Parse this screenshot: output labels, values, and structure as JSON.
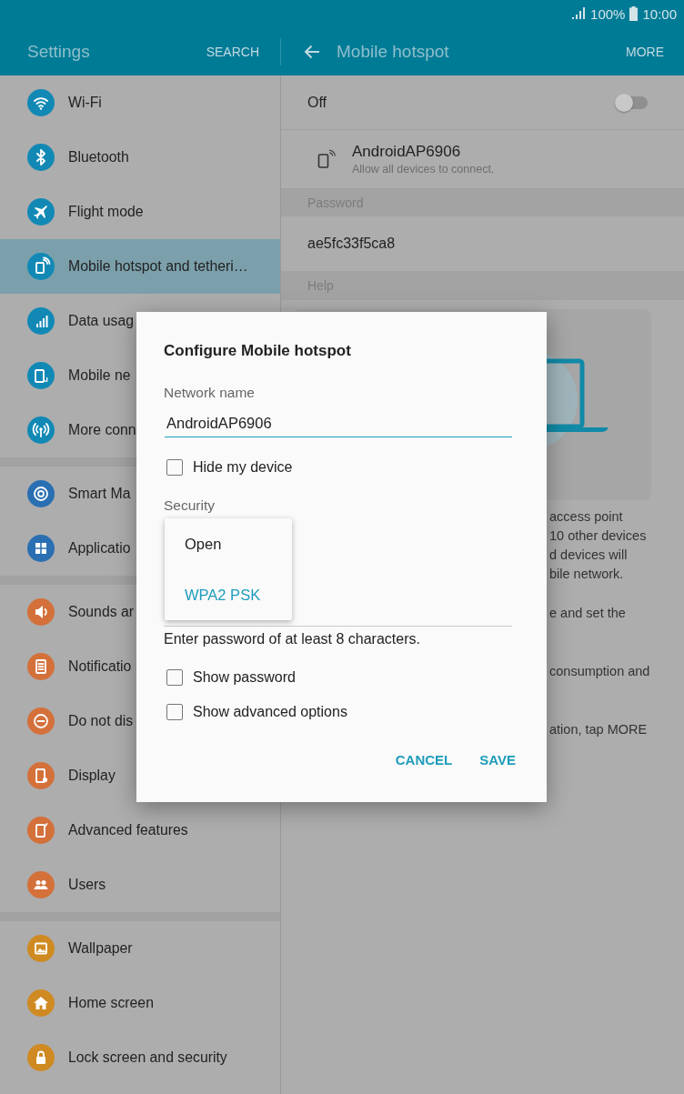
{
  "status_bar": {
    "battery": "100%",
    "time": "10:00"
  },
  "app_bar": {
    "title": "Settings",
    "search": "SEARCH",
    "detail_title": "Mobile hotspot",
    "more": "MORE"
  },
  "sidebar": {
    "groups": [
      {
        "items": [
          {
            "label": "Wi-Fi",
            "color": "#1289b5",
            "selected": false
          },
          {
            "label": "Bluetooth",
            "color": "#1289b5",
            "selected": false
          },
          {
            "label": "Flight mode",
            "color": "#1289b5",
            "selected": false
          },
          {
            "label": "Mobile hotspot and tetheri…",
            "color": "#1289b5",
            "selected": true
          },
          {
            "label": "Data usag",
            "color": "#1289b5",
            "selected": false
          },
          {
            "label": "Mobile ne",
            "color": "#1289b5",
            "selected": false
          },
          {
            "label": "More conn",
            "color": "#1289b5",
            "selected": false
          }
        ]
      },
      {
        "items": [
          {
            "label": "Smart Ma",
            "color": "#2a6fb2",
            "selected": false
          },
          {
            "label": "Applicatio",
            "color": "#2a6fb2",
            "selected": false
          }
        ]
      },
      {
        "items": [
          {
            "label": "Sounds ar",
            "color": "#d4703a",
            "selected": false
          },
          {
            "label": "Notificatio",
            "color": "#d4703a",
            "selected": false
          },
          {
            "label": "Do not dis",
            "color": "#d4703a",
            "selected": false
          },
          {
            "label": "Display",
            "color": "#d4703a",
            "selected": false
          },
          {
            "label": "Advanced features",
            "color": "#d4703a",
            "selected": false
          },
          {
            "label": "Users",
            "color": "#d4703a",
            "selected": false
          }
        ]
      },
      {
        "items": [
          {
            "label": "Wallpaper",
            "color": "#cf8a22",
            "selected": false
          },
          {
            "label": "Home screen",
            "color": "#cf8a22",
            "selected": false
          },
          {
            "label": "Lock screen and security",
            "color": "#cf8a22",
            "selected": false
          }
        ]
      }
    ]
  },
  "hotspot": {
    "switch_label": "Off",
    "on": false,
    "network": {
      "name": "AndroidAP6906",
      "subtitle": "Allow all devices to connect."
    },
    "password_header": "Password",
    "password": "ae5fc33f5ca8",
    "help_header": "Help",
    "help_paragraphs": [
      [
        "access point",
        "10 other devices",
        "d devices will",
        "bile network."
      ],
      [
        "e and set the"
      ],
      [
        "consumption and"
      ],
      [
        "ation, tap MORE"
      ]
    ]
  },
  "dialog": {
    "title": "Configure Mobile hotspot",
    "network_name_label": "Network name",
    "network_name": "AndroidAP6906",
    "hide_device": {
      "label": "Hide my device",
      "checked": false
    },
    "security_label": "Security",
    "security_options": [
      {
        "label": "Open",
        "selected": false
      },
      {
        "label": "WPA2 PSK",
        "selected": true
      }
    ],
    "password_hint": "Enter password of at least 8 characters.",
    "options": [
      {
        "label": "Show password",
        "checked": false
      },
      {
        "label": "Show advanced options",
        "checked": false
      }
    ],
    "buttons": [
      "CANCEL",
      "SAVE"
    ]
  }
}
